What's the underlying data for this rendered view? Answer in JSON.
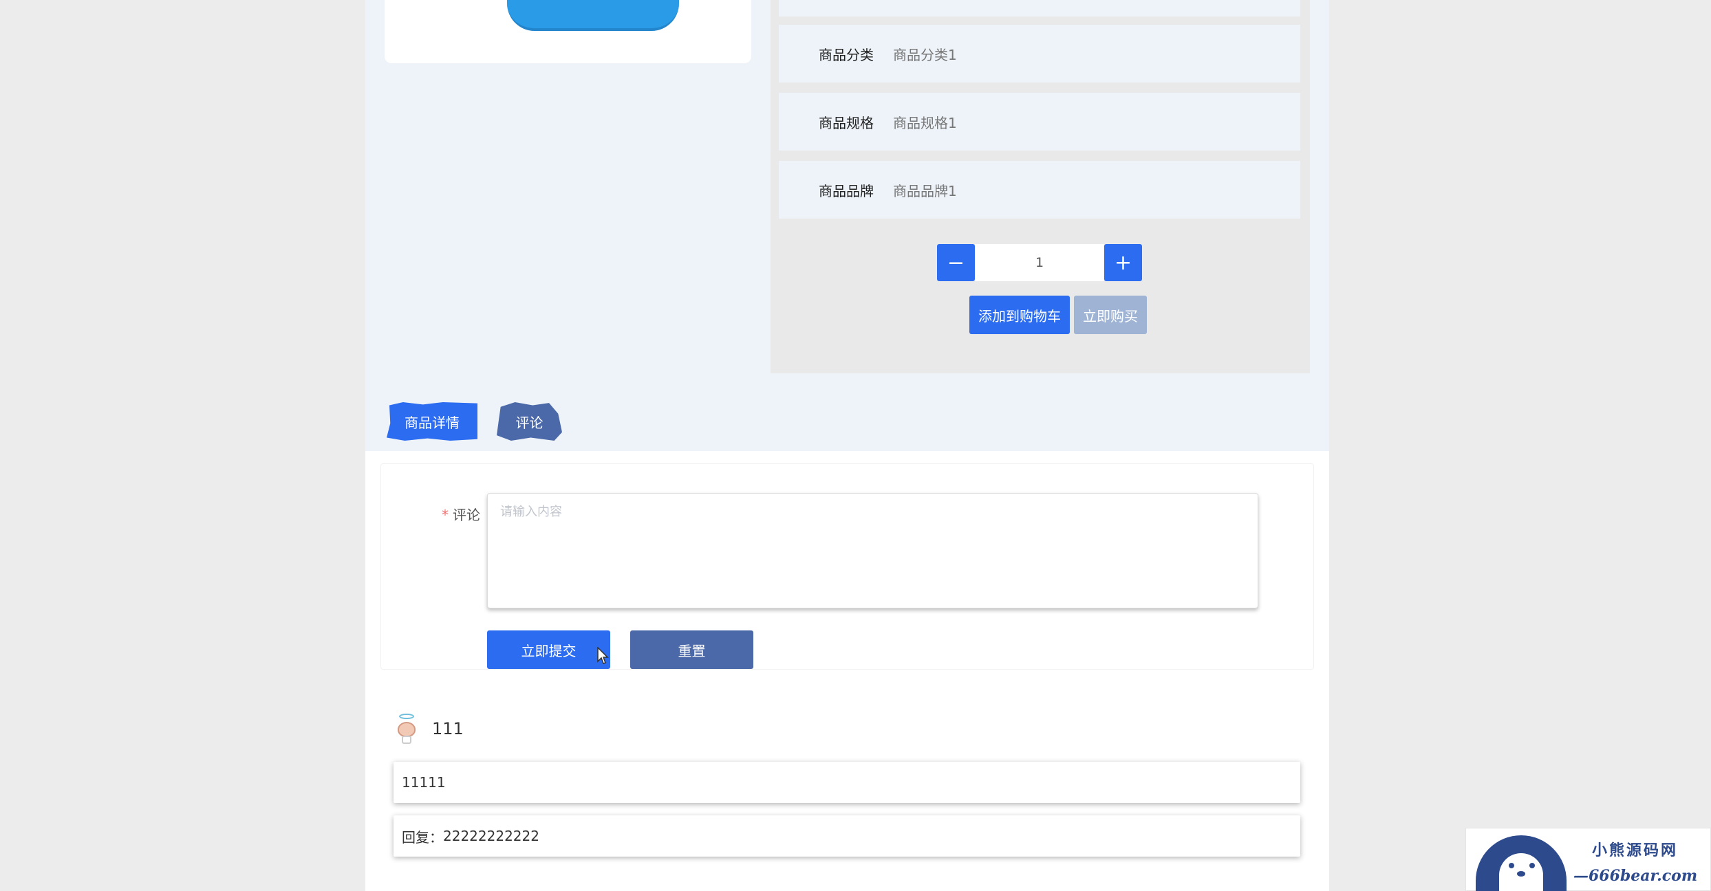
{
  "product": {
    "specs": [
      {
        "label": "商品分类",
        "value": "商品分类1"
      },
      {
        "label": "商品规格",
        "value": "商品规格1"
      },
      {
        "label": "商品品牌",
        "value": "商品品牌1"
      }
    ],
    "quantity": "1",
    "minus_symbol": "−",
    "plus_symbol": "+",
    "add_to_cart_label": "添加到购物车",
    "buy_now_label": "立即购买"
  },
  "tabs": [
    {
      "label": "商品详情",
      "active": true
    },
    {
      "label": "评论",
      "active": false
    }
  ],
  "comment_form": {
    "required_mark": "*",
    "label": "评论",
    "placeholder": "请输入内容",
    "submit_label": "立即提交",
    "reset_label": "重置"
  },
  "comments": [
    {
      "username": "111",
      "content": "11111",
      "reply_prefix": "回复：",
      "reply": "22222222222"
    }
  ],
  "watermark": {
    "title": "小熊源码网",
    "url": "—666bear.com—"
  },
  "colors": {
    "primary": "#2c6cf0",
    "secondary": "#4b69a8",
    "disabled": "#9fb4d4",
    "panel_bg": "#edf3f9"
  }
}
